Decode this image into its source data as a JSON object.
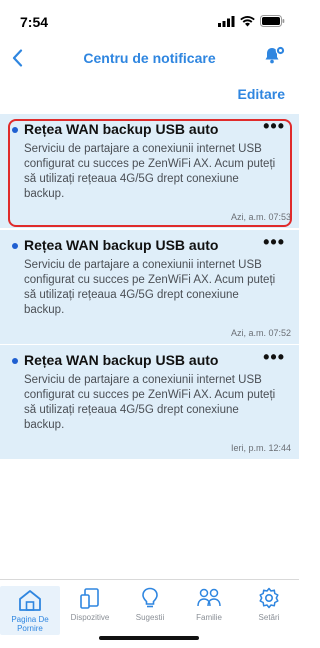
{
  "status": {
    "time": "7:54"
  },
  "nav": {
    "title": "Centru de notificare",
    "edit_label": "Editare"
  },
  "notifications": [
    {
      "title": "Rețea WAN backup USB auto",
      "body": "Serviciu de partajare a conexiunii internet USB configurat cu succes pe ZenWiFi AX. Acum puteți să utilizați rețeaua 4G/5G drept conexiune backup.",
      "time": "Azi, a.m. 07:53",
      "more": "•••"
    },
    {
      "title": "Rețea WAN backup USB auto",
      "body": "Serviciu de partajare a conexiunii internet USB configurat cu succes pe ZenWiFi AX. Acum puteți să utilizați rețeaua 4G/5G drept conexiune backup.",
      "time": "Azi, a.m. 07:52",
      "more": "•••"
    },
    {
      "title": "Rețea WAN backup USB auto",
      "body": "Serviciu de partajare a conexiunii internet USB configurat cu succes pe ZenWiFi AX. Acum puteți să utilizați rețeaua 4G/5G drept conexiune backup.",
      "time": "Ieri, p.m. 12:44",
      "more": "•••"
    }
  ],
  "tabs": [
    {
      "label": "Pagina De Pornire",
      "icon": "home-icon"
    },
    {
      "label": "Dispozitive",
      "icon": "devices-icon"
    },
    {
      "label": "Sugestii",
      "icon": "lightbulb-icon"
    },
    {
      "label": "Familie",
      "icon": "family-icon"
    },
    {
      "label": "Setări",
      "icon": "gear-icon"
    }
  ],
  "colors": {
    "accent": "#2f86e0",
    "card_bg": "#dfeef9",
    "highlight": "#e02b2b",
    "unread_dot": "#1f5fd1"
  }
}
